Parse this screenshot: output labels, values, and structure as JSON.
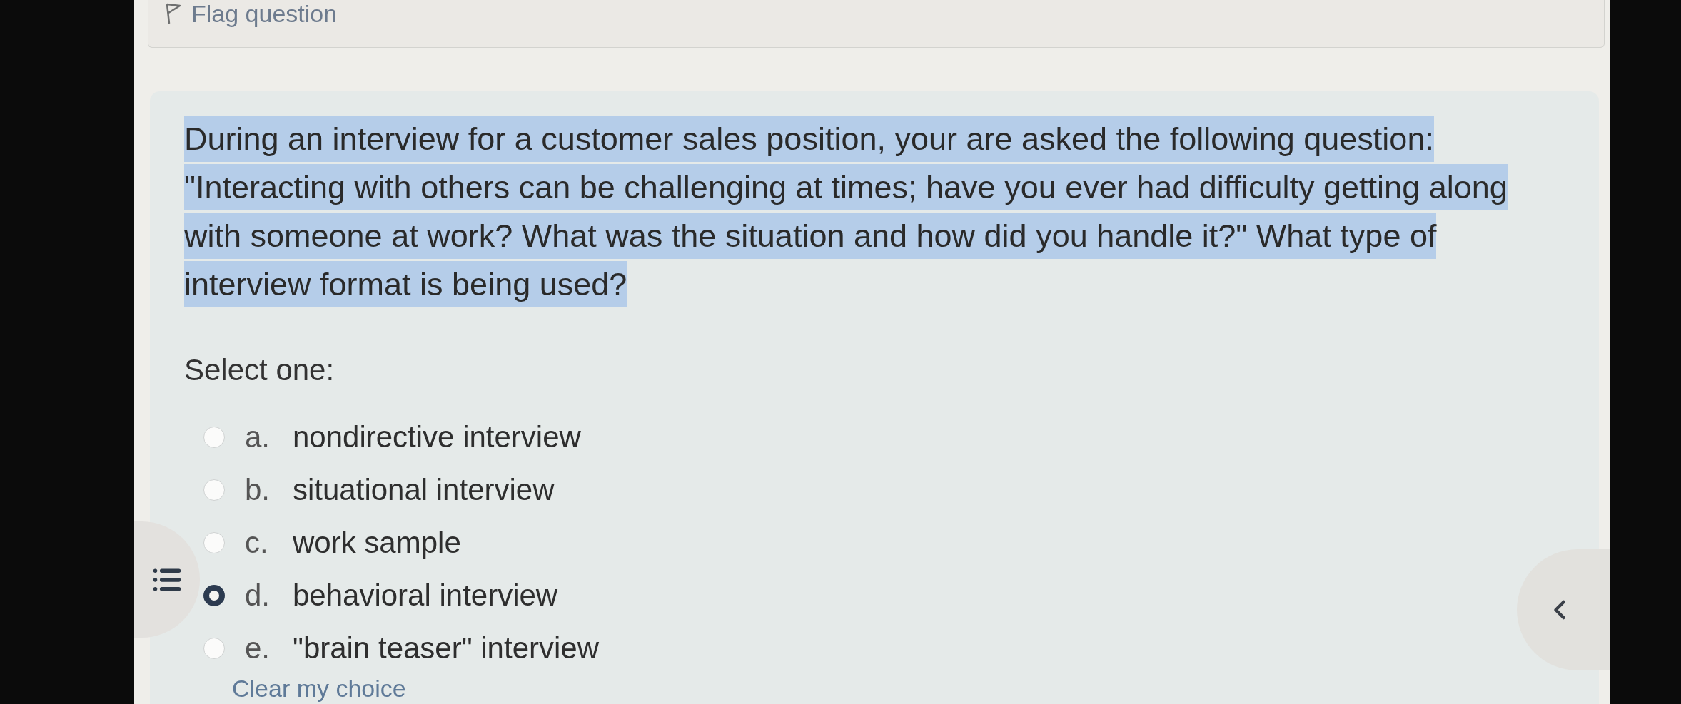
{
  "flag": {
    "label": "Flag question"
  },
  "question": {
    "text": "During an interview for a customer sales position, your are asked the following question: \"Interacting with others can be challenging at times; have you ever had difficulty getting along with someone at work? What was the situation and how did you handle it?\" What type of interview format is being used?",
    "highlighted": true
  },
  "prompt": "Select one:",
  "options": [
    {
      "letter": "a.",
      "label": "nondirective interview",
      "selected": false
    },
    {
      "letter": "b.",
      "label": "situational interview",
      "selected": false
    },
    {
      "letter": "c.",
      "label": "work sample",
      "selected": false
    },
    {
      "letter": "d.",
      "label": "behavioral interview",
      "selected": true
    },
    {
      "letter": "e.",
      "label": "\"brain teaser\" interview",
      "selected": false
    }
  ],
  "clear_link": "Clear my choice"
}
